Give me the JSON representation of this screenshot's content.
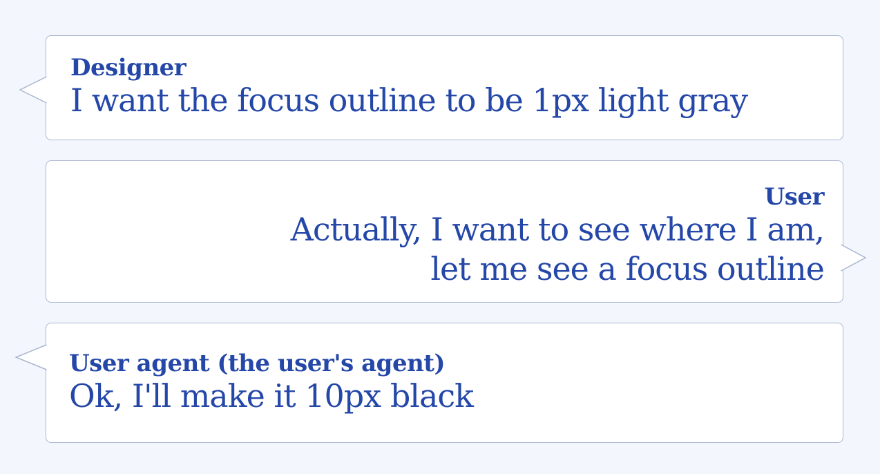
{
  "theme": {
    "background": "#f3f7fd",
    "bubble_fill": "#ffffff",
    "bubble_border": "#a9b6cf",
    "text_color": "#2447a8"
  },
  "messages": [
    {
      "speaker": "Designer",
      "lines": [
        "I want the focus outline to be 1px light gray"
      ],
      "tail_side": "left"
    },
    {
      "speaker": "User",
      "lines": [
        "Actually, I want to see where I am,",
        "let me see a focus outline"
      ],
      "tail_side": "right"
    },
    {
      "speaker": "User agent (the user's agent)",
      "lines": [
        "Ok, I'll make it 10px black"
      ],
      "tail_side": "left"
    }
  ]
}
